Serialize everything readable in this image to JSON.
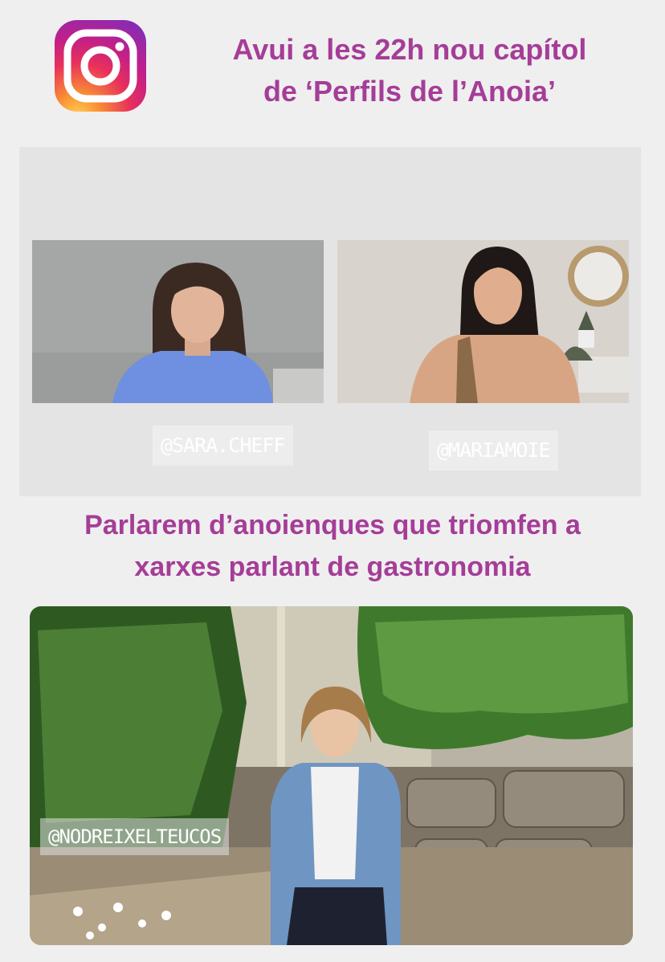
{
  "headline": {
    "line1": "Avui a les 22h nou capítol",
    "line2": "de ‘Perfils de l’Anoia’"
  },
  "video_call": {
    "participants": [
      {
        "handle": "@SARA.CHEFF"
      },
      {
        "handle": "@MARIAMOIE"
      }
    ]
  },
  "subheadline": {
    "line1": "Parlarem d’anoienques que triomfen a",
    "line2": "xarxes parlant de gastronomia"
  },
  "photo": {
    "handle": "@NODREIXELTEUCOS"
  },
  "colors": {
    "accent": "#a53d98",
    "background": "#efefef",
    "panel": "#e4e4e4"
  },
  "icons": [
    "instagram-icon"
  ]
}
